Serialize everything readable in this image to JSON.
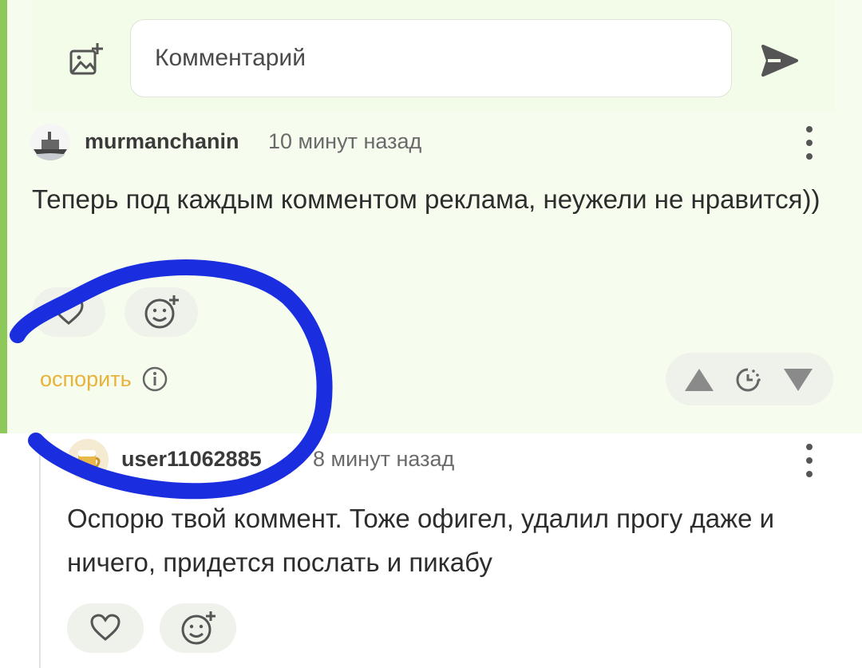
{
  "composer": {
    "placeholder": "Комментарий"
  },
  "comments": [
    {
      "author": "murmanchanin",
      "time": "10 минут назад",
      "text": "Теперь под каждым комментом реклама, неужели не нравится))",
      "dispute_label": "оспорить"
    },
    {
      "author": "user11062885",
      "time": "8 минут назад",
      "text": "Оспорю твой коммент. Тоже офигел, удалил прогу даже и ничего, придется послать и пикабу"
    }
  ],
  "icons": {
    "image_add": "image-add-icon",
    "send": "send-icon",
    "more": "more-vertical-icon",
    "like": "heart-icon",
    "emoji": "emoji-add-icon",
    "info": "info-icon",
    "upvote": "triangle-up-icon",
    "timer": "timer-icon",
    "downvote": "triangle-down-icon"
  },
  "colors": {
    "accent_green": "#8cc85a",
    "highlight_bg": "#f6fdee",
    "dispute": "#e8b33a",
    "annotation_blue": "#1a2ee0"
  }
}
